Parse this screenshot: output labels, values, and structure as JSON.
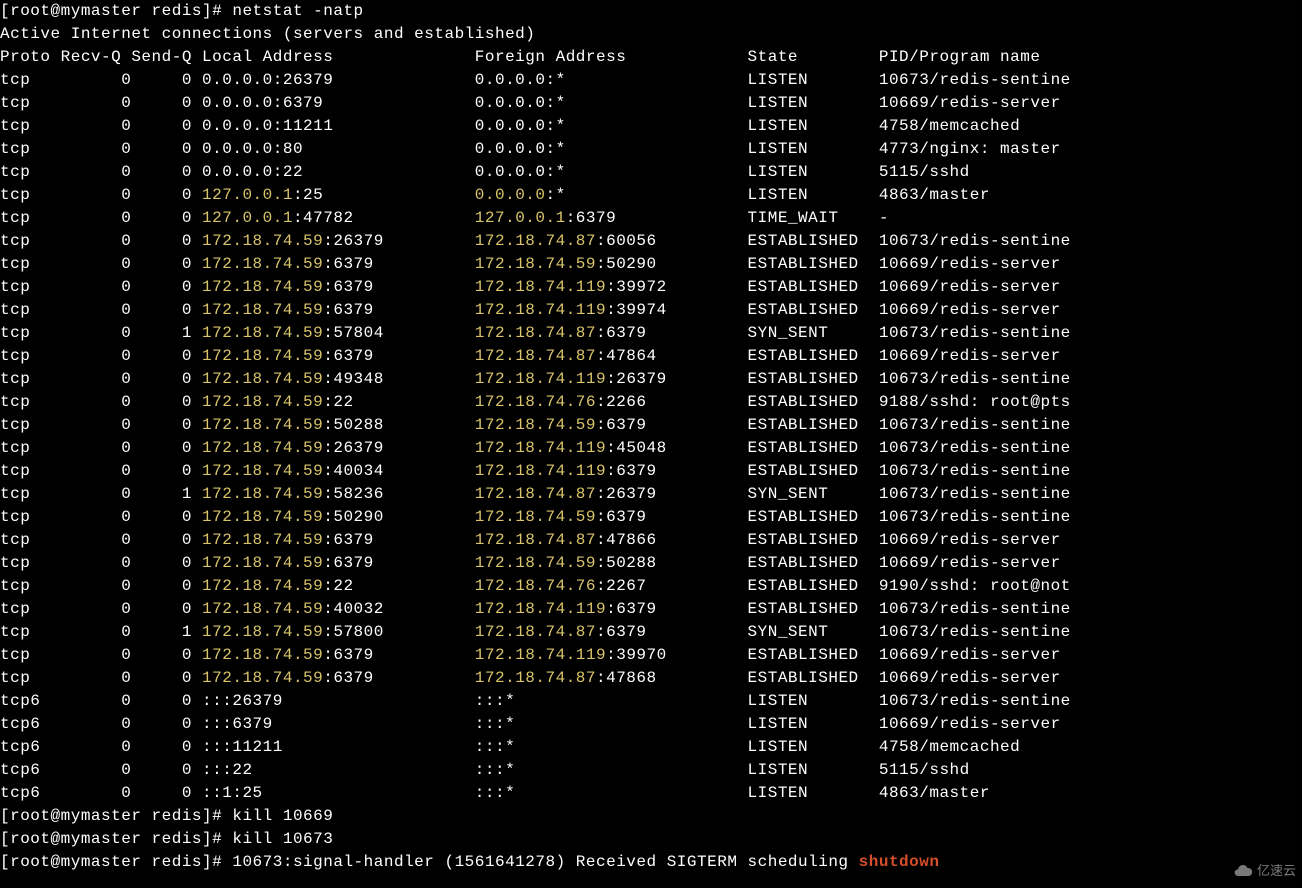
{
  "prompt": {
    "user": "root",
    "host": "mymaster",
    "cwd": "redis",
    "full": "[root@mymaster redis]# "
  },
  "commands": {
    "netstat": "netstat -natp",
    "kill1": "kill 10669",
    "kill2": "kill 10673"
  },
  "banner": "Active Internet connections (servers and established)",
  "header": {
    "proto": "Proto",
    "recvq": "Recv-Q",
    "sendq": "Send-Q",
    "local": "Local Address",
    "foreign": "Foreign Address",
    "state": "State",
    "pid": "PID/Program name"
  },
  "rows": [
    {
      "proto": "tcp",
      "recvq": "0",
      "sendq": "0",
      "local_ip": "0.0.0.0",
      "local_port": ":26379",
      "foreign_ip": "0.0.0.0",
      "foreign_port": ":*",
      "state": "LISTEN",
      "pid": "10673/redis-sentine",
      "hl": false
    },
    {
      "proto": "tcp",
      "recvq": "0",
      "sendq": "0",
      "local_ip": "0.0.0.0",
      "local_port": ":6379",
      "foreign_ip": "0.0.0.0",
      "foreign_port": ":*",
      "state": "LISTEN",
      "pid": "10669/redis-server",
      "hl": false
    },
    {
      "proto": "tcp",
      "recvq": "0",
      "sendq": "0",
      "local_ip": "0.0.0.0",
      "local_port": ":11211",
      "foreign_ip": "0.0.0.0",
      "foreign_port": ":*",
      "state": "LISTEN",
      "pid": "4758/memcached",
      "hl": false
    },
    {
      "proto": "tcp",
      "recvq": "0",
      "sendq": "0",
      "local_ip": "0.0.0.0",
      "local_port": ":80",
      "foreign_ip": "0.0.0.0",
      "foreign_port": ":*",
      "state": "LISTEN",
      "pid": "4773/nginx: master",
      "hl": false
    },
    {
      "proto": "tcp",
      "recvq": "0",
      "sendq": "0",
      "local_ip": "0.0.0.0",
      "local_port": ":22",
      "foreign_ip": "0.0.0.0",
      "foreign_port": ":*",
      "state": "LISTEN",
      "pid": "5115/sshd",
      "hl": false
    },
    {
      "proto": "tcp",
      "recvq": "0",
      "sendq": "0",
      "local_ip": "127.0.0.1",
      "local_port": ":25",
      "foreign_ip": "0.0.0.0",
      "foreign_port": ":*",
      "state": "LISTEN",
      "pid": "4863/master",
      "hl": true
    },
    {
      "proto": "tcp",
      "recvq": "0",
      "sendq": "0",
      "local_ip": "127.0.0.1",
      "local_port": ":47782",
      "foreign_ip": "127.0.0.1",
      "foreign_port": ":6379",
      "state": "TIME_WAIT",
      "pid": "-",
      "hl": true
    },
    {
      "proto": "tcp",
      "recvq": "0",
      "sendq": "0",
      "local_ip": "172.18.74.59",
      "local_port": ":26379",
      "foreign_ip": "172.18.74.87",
      "foreign_port": ":60056",
      "state": "ESTABLISHED",
      "pid": "10673/redis-sentine",
      "hl": true
    },
    {
      "proto": "tcp",
      "recvq": "0",
      "sendq": "0",
      "local_ip": "172.18.74.59",
      "local_port": ":6379",
      "foreign_ip": "172.18.74.59",
      "foreign_port": ":50290",
      "state": "ESTABLISHED",
      "pid": "10669/redis-server",
      "hl": true
    },
    {
      "proto": "tcp",
      "recvq": "0",
      "sendq": "0",
      "local_ip": "172.18.74.59",
      "local_port": ":6379",
      "foreign_ip": "172.18.74.119",
      "foreign_port": ":39972",
      "state": "ESTABLISHED",
      "pid": "10669/redis-server",
      "hl": true
    },
    {
      "proto": "tcp",
      "recvq": "0",
      "sendq": "0",
      "local_ip": "172.18.74.59",
      "local_port": ":6379",
      "foreign_ip": "172.18.74.119",
      "foreign_port": ":39974",
      "state": "ESTABLISHED",
      "pid": "10669/redis-server",
      "hl": true
    },
    {
      "proto": "tcp",
      "recvq": "0",
      "sendq": "1",
      "local_ip": "172.18.74.59",
      "local_port": ":57804",
      "foreign_ip": "172.18.74.87",
      "foreign_port": ":6379",
      "state": "SYN_SENT",
      "pid": "10673/redis-sentine",
      "hl": true
    },
    {
      "proto": "tcp",
      "recvq": "0",
      "sendq": "0",
      "local_ip": "172.18.74.59",
      "local_port": ":6379",
      "foreign_ip": "172.18.74.87",
      "foreign_port": ":47864",
      "state": "ESTABLISHED",
      "pid": "10669/redis-server",
      "hl": true
    },
    {
      "proto": "tcp",
      "recvq": "0",
      "sendq": "0",
      "local_ip": "172.18.74.59",
      "local_port": ":49348",
      "foreign_ip": "172.18.74.119",
      "foreign_port": ":26379",
      "state": "ESTABLISHED",
      "pid": "10673/redis-sentine",
      "hl": true
    },
    {
      "proto": "tcp",
      "recvq": "0",
      "sendq": "0",
      "local_ip": "172.18.74.59",
      "local_port": ":22",
      "foreign_ip": "172.18.74.76",
      "foreign_port": ":2266",
      "state": "ESTABLISHED",
      "pid": "9188/sshd: root@pts",
      "hl": true
    },
    {
      "proto": "tcp",
      "recvq": "0",
      "sendq": "0",
      "local_ip": "172.18.74.59",
      "local_port": ":50288",
      "foreign_ip": "172.18.74.59",
      "foreign_port": ":6379",
      "state": "ESTABLISHED",
      "pid": "10673/redis-sentine",
      "hl": true
    },
    {
      "proto": "tcp",
      "recvq": "0",
      "sendq": "0",
      "local_ip": "172.18.74.59",
      "local_port": ":26379",
      "foreign_ip": "172.18.74.119",
      "foreign_port": ":45048",
      "state": "ESTABLISHED",
      "pid": "10673/redis-sentine",
      "hl": true
    },
    {
      "proto": "tcp",
      "recvq": "0",
      "sendq": "0",
      "local_ip": "172.18.74.59",
      "local_port": ":40034",
      "foreign_ip": "172.18.74.119",
      "foreign_port": ":6379",
      "state": "ESTABLISHED",
      "pid": "10673/redis-sentine",
      "hl": true
    },
    {
      "proto": "tcp",
      "recvq": "0",
      "sendq": "1",
      "local_ip": "172.18.74.59",
      "local_port": ":58236",
      "foreign_ip": "172.18.74.87",
      "foreign_port": ":26379",
      "state": "SYN_SENT",
      "pid": "10673/redis-sentine",
      "hl": true
    },
    {
      "proto": "tcp",
      "recvq": "0",
      "sendq": "0",
      "local_ip": "172.18.74.59",
      "local_port": ":50290",
      "foreign_ip": "172.18.74.59",
      "foreign_port": ":6379",
      "state": "ESTABLISHED",
      "pid": "10673/redis-sentine",
      "hl": true
    },
    {
      "proto": "tcp",
      "recvq": "0",
      "sendq": "0",
      "local_ip": "172.18.74.59",
      "local_port": ":6379",
      "foreign_ip": "172.18.74.87",
      "foreign_port": ":47866",
      "state": "ESTABLISHED",
      "pid": "10669/redis-server",
      "hl": true
    },
    {
      "proto": "tcp",
      "recvq": "0",
      "sendq": "0",
      "local_ip": "172.18.74.59",
      "local_port": ":6379",
      "foreign_ip": "172.18.74.59",
      "foreign_port": ":50288",
      "state": "ESTABLISHED",
      "pid": "10669/redis-server",
      "hl": true
    },
    {
      "proto": "tcp",
      "recvq": "0",
      "sendq": "0",
      "local_ip": "172.18.74.59",
      "local_port": ":22",
      "foreign_ip": "172.18.74.76",
      "foreign_port": ":2267",
      "state": "ESTABLISHED",
      "pid": "9190/sshd: root@not",
      "hl": true
    },
    {
      "proto": "tcp",
      "recvq": "0",
      "sendq": "0",
      "local_ip": "172.18.74.59",
      "local_port": ":40032",
      "foreign_ip": "172.18.74.119",
      "foreign_port": ":6379",
      "state": "ESTABLISHED",
      "pid": "10673/redis-sentine",
      "hl": true
    },
    {
      "proto": "tcp",
      "recvq": "0",
      "sendq": "1",
      "local_ip": "172.18.74.59",
      "local_port": ":57800",
      "foreign_ip": "172.18.74.87",
      "foreign_port": ":6379",
      "state": "SYN_SENT",
      "pid": "10673/redis-sentine",
      "hl": true
    },
    {
      "proto": "tcp",
      "recvq": "0",
      "sendq": "0",
      "local_ip": "172.18.74.59",
      "local_port": ":6379",
      "foreign_ip": "172.18.74.119",
      "foreign_port": ":39970",
      "state": "ESTABLISHED",
      "pid": "10669/redis-server",
      "hl": true
    },
    {
      "proto": "tcp",
      "recvq": "0",
      "sendq": "0",
      "local_ip": "172.18.74.59",
      "local_port": ":6379",
      "foreign_ip": "172.18.74.87",
      "foreign_port": ":47868",
      "state": "ESTABLISHED",
      "pid": "10669/redis-server",
      "hl": true
    },
    {
      "proto": "tcp6",
      "recvq": "0",
      "sendq": "0",
      "local_ip": ":::26379",
      "local_port": "",
      "foreign_ip": ":::*",
      "foreign_port": "",
      "state": "LISTEN",
      "pid": "10673/redis-sentine",
      "hl": false
    },
    {
      "proto": "tcp6",
      "recvq": "0",
      "sendq": "0",
      "local_ip": ":::6379",
      "local_port": "",
      "foreign_ip": ":::*",
      "foreign_port": "",
      "state": "LISTEN",
      "pid": "10669/redis-server",
      "hl": false
    },
    {
      "proto": "tcp6",
      "recvq": "0",
      "sendq": "0",
      "local_ip": ":::11211",
      "local_port": "",
      "foreign_ip": ":::*",
      "foreign_port": "",
      "state": "LISTEN",
      "pid": "4758/memcached",
      "hl": false
    },
    {
      "proto": "tcp6",
      "recvq": "0",
      "sendq": "0",
      "local_ip": ":::22",
      "local_port": "",
      "foreign_ip": ":::*",
      "foreign_port": "",
      "state": "LISTEN",
      "pid": "5115/sshd",
      "hl": false
    },
    {
      "proto": "tcp6",
      "recvq": "0",
      "sendq": "0",
      "local_ip": "::1:25",
      "local_port": "",
      "foreign_ip": ":::*",
      "foreign_port": "",
      "state": "LISTEN",
      "pid": "4863/master",
      "hl": false
    }
  ],
  "signal_line": {
    "text": "10673:signal-handler (1561641278) Received SIGTERM scheduling ",
    "shutdown": "shutdown"
  },
  "watermark": "亿速云"
}
